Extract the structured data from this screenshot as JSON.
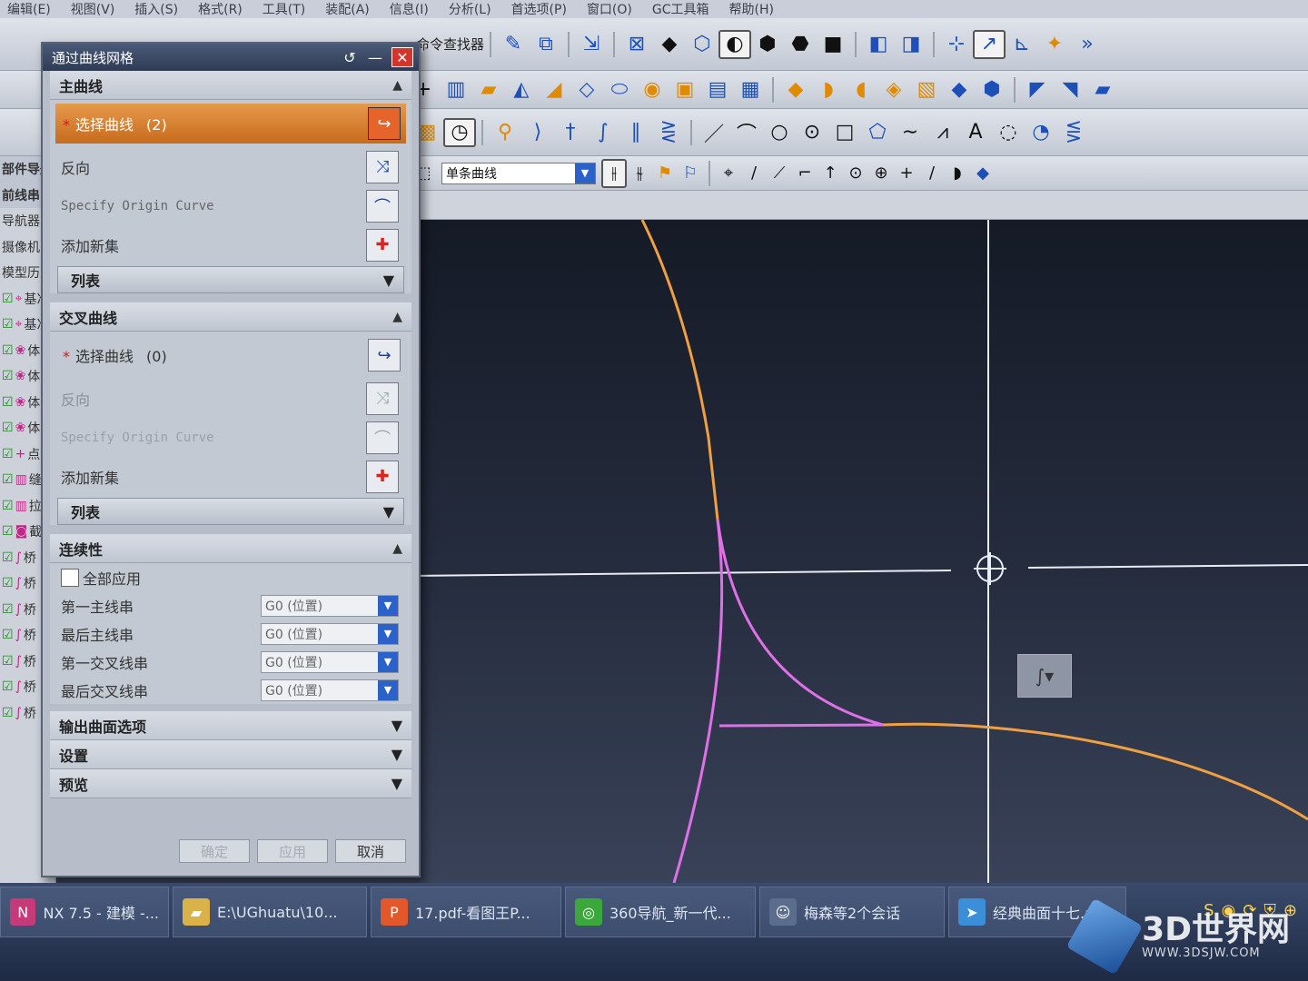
{
  "menu": [
    "编辑(E)",
    "视图(V)",
    "插入(S)",
    "格式(R)",
    "工具(T)",
    "装配(A)",
    "信息(I)",
    "分析(L)",
    "首选项(P)",
    "窗口(O)",
    "GC工具箱",
    "帮助(H)"
  ],
  "toolbar": {
    "command_finder": "命令查找器",
    "filter_value": "单条曲线"
  },
  "navigator": {
    "labels": [
      "部件导航器",
      "前线串",
      "导航器",
      "摄像机",
      "模型历史记录",
      "基准",
      "基准",
      "体",
      "体",
      "体",
      "体",
      "点",
      "缝",
      "拉",
      "截",
      "桥",
      "桥",
      "桥",
      "桥",
      "桥",
      "桥",
      "桥"
    ]
  },
  "dialog": {
    "title": "通过曲线网格",
    "primary": {
      "header": "主曲线",
      "select_label": "选择曲线",
      "select_count": "(2)",
      "reverse": "反向",
      "origin": "Specify Origin Curve",
      "add_set": "添加新集",
      "list": "列表"
    },
    "cross": {
      "header": "交叉曲线",
      "select_label": "选择曲线",
      "select_count": "(0)",
      "reverse": "反向",
      "origin": "Specify Origin Curve",
      "add_set": "添加新集",
      "list": "列表"
    },
    "continuity": {
      "header": "连续性",
      "apply_all": "全部应用",
      "rows": [
        {
          "label": "第一主线串",
          "value": "G0 (位置)"
        },
        {
          "label": "最后主线串",
          "value": "G0 (位置)"
        },
        {
          "label": "第一交叉线串",
          "value": "G0 (位置)"
        },
        {
          "label": "最后交叉线串",
          "value": "G0 (位置)"
        }
      ]
    },
    "output_options": "输出曲面选项",
    "settings": "设置",
    "preview": "预览",
    "ok": "确定",
    "apply": "应用",
    "cancel": "取消"
  },
  "taskbar": {
    "items": [
      {
        "label": "NX 7.5 - 建模 -..."
      },
      {
        "label": "E:\\UGhuatu\\10..."
      },
      {
        "label": "17.pdf-看图王P..."
      },
      {
        "label": "360导航_新一代..."
      },
      {
        "label": "梅森等2个会话"
      },
      {
        "label": "经典曲面十七.avi"
      }
    ]
  },
  "watermark": {
    "name": "3D世界网",
    "url": "WWW.3DSJW.COM"
  },
  "colors": {
    "selected_curve": "#f0a040",
    "highlight_curve": "#e070e8",
    "active_select": "#e08a30"
  },
  "icons": [
    "pick-curve-icon",
    "reverse-icon",
    "origin-curve-icon",
    "add-set-icon",
    "chevron-up-icon",
    "chevron-down-icon",
    "close-icon",
    "minimize-icon",
    "reset-icon",
    "snap-curve-icon"
  ]
}
